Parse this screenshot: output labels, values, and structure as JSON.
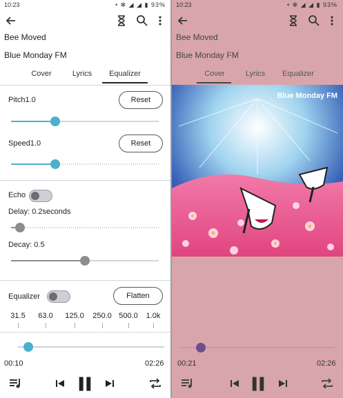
{
  "status": {
    "time": "10:23",
    "battery": "93%"
  },
  "track": {
    "title": "Bee Moved",
    "station": "Blue Monday FM"
  },
  "tabs": [
    "Cover",
    "Lyrics",
    "Equalizer"
  ],
  "left": {
    "active_tab": "Equalizer",
    "pitch": {
      "label": "Pitch1.0",
      "reset": "Reset",
      "level": 0.3
    },
    "speed": {
      "label": "Speed1.0",
      "reset": "Reset",
      "level": 0.3
    },
    "echo": {
      "label": "Echo",
      "enabled": false,
      "delay_label": "Delay: 0.2seconds",
      "delay_level": 0.06,
      "decay_label": "Decay: 0.5",
      "decay_level": 0.5
    },
    "equalizer": {
      "label": "Equalizer",
      "enabled": false,
      "flatten": "Flatten",
      "bands": [
        "31.5",
        "63.0",
        "125.0",
        "250.0",
        "500.0",
        "1.0k"
      ]
    },
    "player": {
      "elapsed": "00:10",
      "duration": "02:26",
      "progress": 0.07
    }
  },
  "right": {
    "active_tab": "Cover",
    "art_title": "Blue Monday FM",
    "player": {
      "elapsed": "00:21",
      "duration": "02:26",
      "progress": 0.14
    }
  },
  "colors": {
    "accent": "#4ab0cc",
    "right_bg": "#d8a6aa",
    "right_thumb": "#6a4f8c"
  }
}
